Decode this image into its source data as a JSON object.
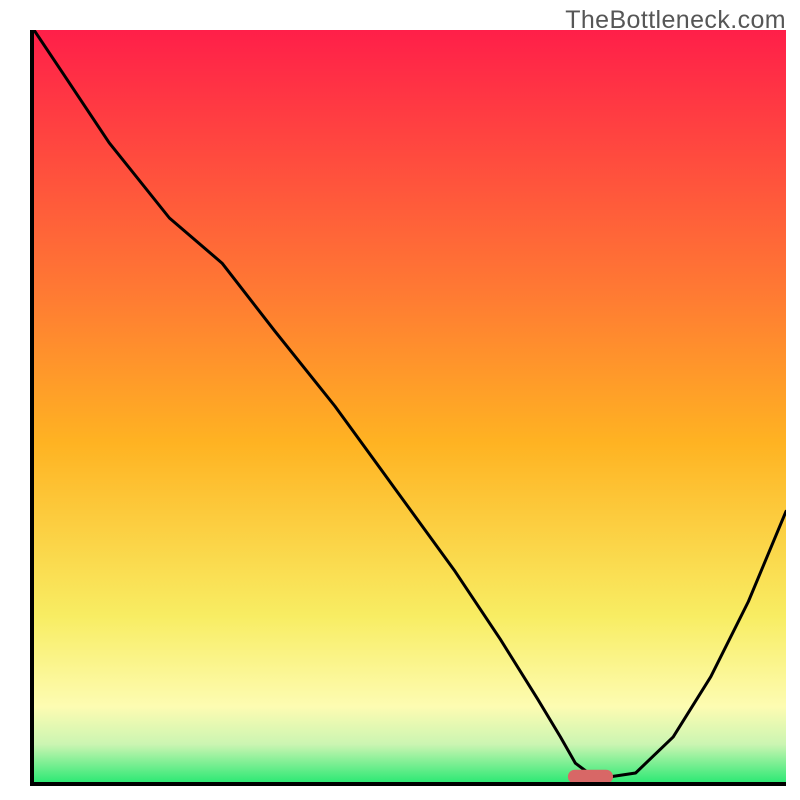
{
  "watermark": "TheBottleneck.com",
  "colors": {
    "gradient_top": "#ff1f49",
    "gradient_mid": "#ffb322",
    "gradient_low": "#f8ed63",
    "gradient_yellow_pale": "#fdfcb2",
    "gradient_green_pale": "#cbf5b2",
    "gradient_green": "#2fe975",
    "line": "#000000",
    "marker": "#d86766"
  },
  "chart_data": {
    "type": "line",
    "title": "",
    "xlabel": "",
    "ylabel": "",
    "xlim": [
      0,
      100
    ],
    "ylim": [
      0,
      100
    ],
    "x": [
      0,
      4,
      10,
      18,
      25,
      32,
      40,
      48,
      56,
      62,
      67,
      70,
      72,
      74,
      76,
      80,
      85,
      90,
      95,
      100
    ],
    "y": [
      100,
      94,
      85,
      75,
      69,
      60,
      50,
      39,
      28,
      19,
      11,
      6,
      2.5,
      1,
      0.6,
      1.2,
      6,
      14,
      24,
      36
    ],
    "marker_x_range": [
      71,
      77
    ],
    "marker_y": 0.7
  }
}
